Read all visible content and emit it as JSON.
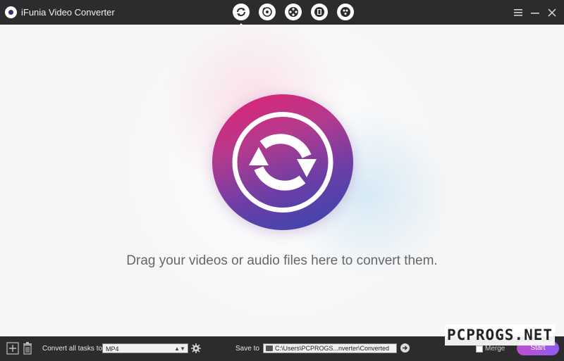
{
  "titlebar": {
    "app_title": "iFunia Video Converter",
    "modes": [
      {
        "icon": "convert-icon",
        "active": true
      },
      {
        "icon": "rip-disc-icon",
        "active": false
      },
      {
        "icon": "film-reel-icon",
        "active": false
      },
      {
        "icon": "dvd-film-icon",
        "active": false
      },
      {
        "icon": "burn-film-icon",
        "active": false
      }
    ],
    "window_controls": [
      "menu-icon",
      "minimize-icon",
      "close-icon"
    ]
  },
  "main": {
    "drop_text": "Drag your videos or audio files here to convert them."
  },
  "bottombar": {
    "convert_all_label": "Convert all tasks to",
    "format_value": "MP4",
    "save_to_label": "Save to",
    "save_path": "C:\\Users\\PCPROGS...nverter\\Converted",
    "merge_label": "Merge",
    "merge_checked": false,
    "start_label": "Start"
  },
  "watermark": {
    "text": "PCPROGS.NET"
  },
  "colors": {
    "titlebar_bg": "#2c2c2f",
    "accent_pink": "#e3206f",
    "accent_blue": "#3447b0",
    "start_gradient": [
      "#c04fd0",
      "#8f5cf0"
    ]
  }
}
